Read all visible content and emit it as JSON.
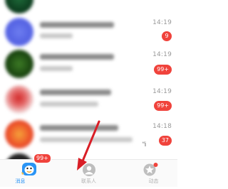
{
  "conversations": [
    {
      "time": "",
      "badge": ""
    },
    {
      "time": "14:19",
      "badge": "9"
    },
    {
      "time": "14:19",
      "badge": "99+"
    },
    {
      "time": "14:19",
      "badge": "99+"
    },
    {
      "time": "14:18",
      "badge": "37"
    }
  ],
  "partial_row_marker": "“i",
  "tabbar": {
    "messages": {
      "label": "消息",
      "badge": "99+"
    },
    "contacts": {
      "label": "联系人"
    },
    "moments": {
      "label": "动态"
    }
  },
  "icons": {
    "messages_tab": "messages-penguin-icon",
    "contacts_tab": "contacts-person-icon",
    "moments_tab": "moments-star-icon",
    "annotation": "red-arrow"
  },
  "colors": {
    "badge": "#f0433c",
    "active_tab": "#2a94f4",
    "inactive_tab": "#b3b3b3",
    "annotation_arrow": "#d91e26"
  }
}
